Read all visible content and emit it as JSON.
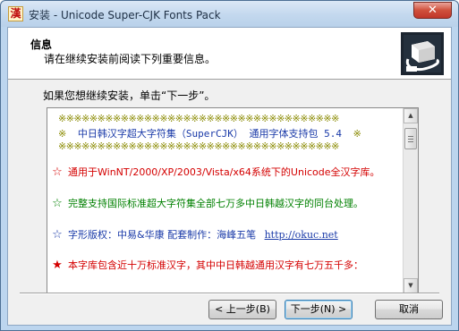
{
  "window": {
    "title": "安装 - Unicode Super-CJK Fonts Pack",
    "app_icon_glyph": "漢",
    "close_glyph": "✕"
  },
  "header": {
    "title": "信息",
    "subtitle": "请在继续安装前阅读下列重要信息。"
  },
  "intro": "如果您想继续安装，单击“下一步”。",
  "info": {
    "stars_row": "※※※※※※※※※※※※※※※※※※※※※※※※※※※※※※※※※※※※",
    "title_star": "※",
    "title_text": "中日韩汉字超大字符集（SuperCJK）  通用字体支持包 5.4",
    "lines": [
      {
        "bullet": "☆",
        "text": "通用于WinNT/2000/XP/2003/Vista/x64系统下的Unicode全汉字库。",
        "color": "#d40000"
      },
      {
        "bullet": "☆",
        "text": "完整支持国际标准超大字符集全部七万多中日韩越汉字的同台处理。",
        "color": "#008000"
      },
      {
        "bullet": "☆",
        "text": "字形版权：中易&华康    配套制作：海峰五笔",
        "link": "http://okuc.net",
        "color": "#1a3aa8"
      },
      {
        "bullet": "★",
        "text": "本字库包含近十万标准汉字，其中中日韩越通用汉字有七万五千多：",
        "color": "#d40000"
      }
    ]
  },
  "scrollbar": {
    "up_glyph": "▲",
    "down_glyph": "▼"
  },
  "buttons": {
    "back": "< 上一步(B)",
    "next": "下一步(N) >",
    "cancel": "取消"
  }
}
